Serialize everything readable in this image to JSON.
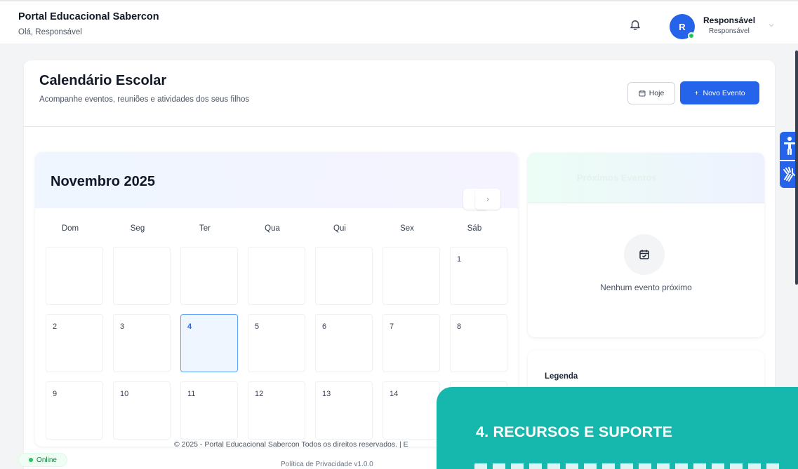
{
  "header": {
    "brand": "Portal Educacional Sabercon",
    "greeting": "Olá, Responsável",
    "user_name": "Responsável",
    "user_role": "Responsável",
    "avatar_initial": "R"
  },
  "page": {
    "title": "Calendário Escolar",
    "subtitle": "Acompanhe eventos, reuniões e atividades dos seus filhos",
    "today_button": "Hoje",
    "new_event_button": "Novo Evento",
    "new_event_icon": "+"
  },
  "calendar": {
    "month_label": "Novembro 2025",
    "prev_label": "‹",
    "next_label": "›",
    "weekdays": [
      "Dom",
      "Seg",
      "Ter",
      "Qua",
      "Qui",
      "Sex",
      "Sáb"
    ],
    "weeks": [
      [
        "",
        "",
        "",
        "",
        "",
        "",
        "1"
      ],
      [
        "2",
        "3",
        "4",
        "5",
        "6",
        "7",
        "8"
      ],
      [
        "9",
        "10",
        "11",
        "12",
        "13",
        "14",
        ""
      ]
    ],
    "today": "4"
  },
  "events": {
    "header_title": "Próximos Eventos",
    "empty_text": "Nenhum evento próximo"
  },
  "legend": {
    "title": "Legenda"
  },
  "footer": {
    "copyright": "© 2025 - Portal Educacional Sabercon Todos os direitos reservados. | E",
    "links": "Política de Privacidade   v1.0.0"
  },
  "status": {
    "label": "Online"
  },
  "overlay": {
    "title": "4.   RECURSOS E SUPORTE"
  },
  "colors": {
    "primary": "#2563eb",
    "today_border": "#60a5fa",
    "online": "#22c55e",
    "overlay": "#16b8ad"
  }
}
